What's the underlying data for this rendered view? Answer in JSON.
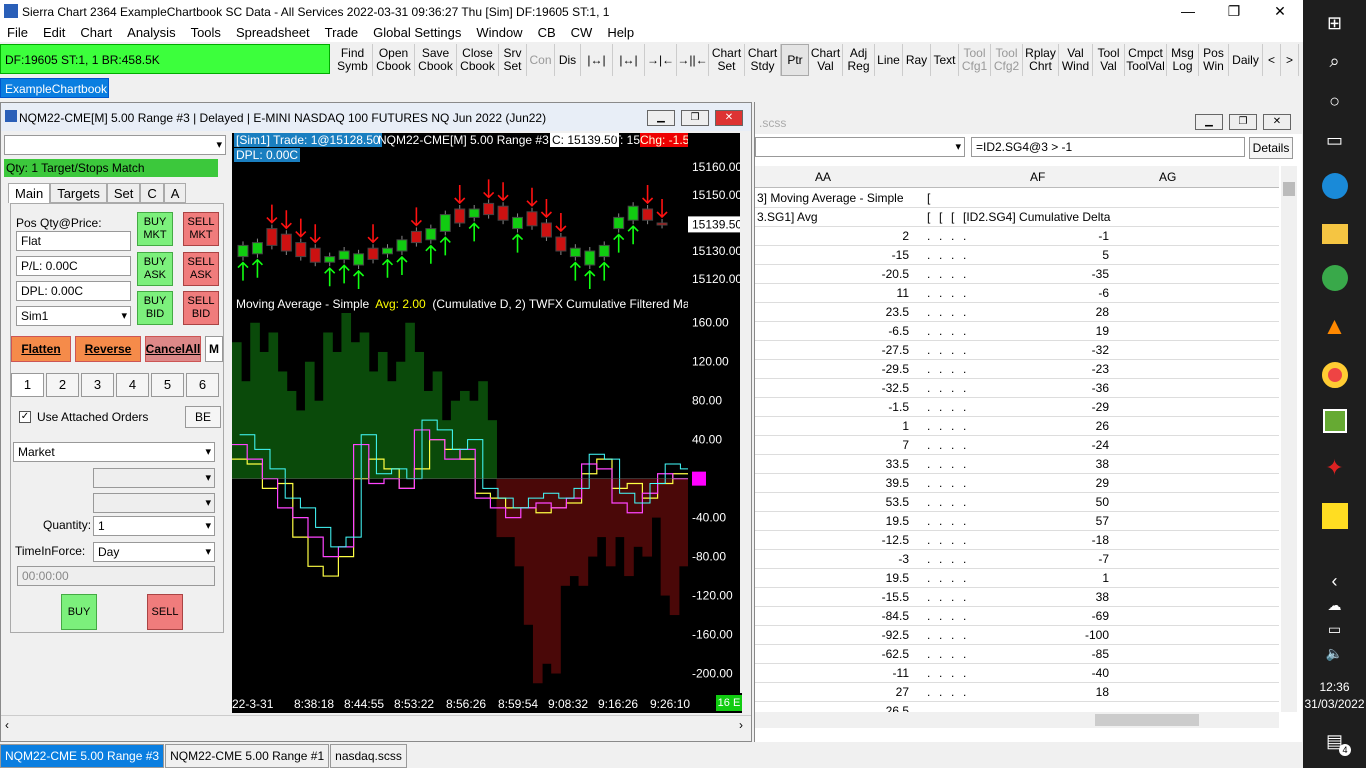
{
  "app": {
    "title": "Sierra Chart 2364 ExampleChartbook  SC Data - All Services 2022-03-31  09:36:27 Thu [Sim]  DF:19605  ST:1, 1"
  },
  "menu": [
    "File",
    "Edit",
    "Chart",
    "Analysis",
    "Tools",
    "Spreadsheet",
    "Trade",
    "Global Settings",
    "Window",
    "CB",
    "CW",
    "Help"
  ],
  "status_bar": "DF:19605  ST:1, 1   BR:458.5K",
  "toolbar": [
    {
      "label": "Find Symb",
      "dis": false
    },
    {
      "label": "Open Cbook",
      "dis": false
    },
    {
      "label": "Save Cbook",
      "dis": false
    },
    {
      "label": "Close Cbook",
      "dis": false
    },
    {
      "label": "Srv Set",
      "dis": false
    },
    {
      "label": "Con",
      "dis": true
    },
    {
      "label": "Dis",
      "dis": false
    },
    {
      "label": "|↔|",
      "dis": false
    },
    {
      "label": "|↔|",
      "dis": false
    },
    {
      "label": "→|←",
      "dis": false
    },
    {
      "label": "→||←",
      "dis": false
    },
    {
      "label": "Chart Set",
      "dis": false
    },
    {
      "label": "Chart Stdy",
      "dis": false
    },
    {
      "label": "Ptr",
      "dis": false
    },
    {
      "label": "Chart Val",
      "dis": false
    },
    {
      "label": "Adj Reg",
      "dis": false
    },
    {
      "label": "Line",
      "dis": false
    },
    {
      "label": "Ray",
      "dis": false
    },
    {
      "label": "Text",
      "dis": false
    },
    {
      "label": "Tool Cfg1",
      "dis": true
    },
    {
      "label": "Tool Cfg2",
      "dis": true
    },
    {
      "label": "Rplay Chrt",
      "dis": false
    },
    {
      "label": "Val Wind",
      "dis": false
    },
    {
      "label": "Tool Val",
      "dis": false
    },
    {
      "label": "Cmpct ToolVal",
      "dis": false
    },
    {
      "label": "Msg Log",
      "dis": false
    },
    {
      "label": "Pos Win",
      "dis": false
    },
    {
      "label": "Daily",
      "dis": false
    },
    {
      "label": "<",
      "dis": false
    },
    {
      "label": ">",
      "dis": false
    }
  ],
  "chartbook_tab": "ExampleChartbook",
  "chart_window": {
    "title": "NQM22-CME[M]  5.00 Range  #3 | Delayed | E-MINI NASDAQ 100 FUTURES NQ Jun 2022 (Jun22)"
  },
  "trade": {
    "target_match": "Qty: 1 Target/Stops Match",
    "tabs": [
      "Main",
      "Targets",
      "Set",
      "C",
      "A"
    ],
    "pos_label": "Pos Qty@Price:",
    "pos_value": "Flat",
    "pl_value": "P/L: 0.00C",
    "dpl_value": "DPL: 0.00C",
    "account": "Sim1",
    "buy_mkt": "BUY MKT",
    "sell_mkt": "SELL MKT",
    "buy_ask": "BUY ASK",
    "sell_ask": "SELL ASK",
    "buy_bid": "BUY BID",
    "sell_bid": "SELL BID",
    "flatten": "Flatten",
    "reverse": "Reverse",
    "cancel_all": "CancelAll",
    "m": "M",
    "nums": [
      "1",
      "2",
      "3",
      "4",
      "5",
      "6"
    ],
    "use_attached": "Use Attached Orders",
    "be": "BE",
    "order_type": "Market",
    "quantity_label": "Quantity:",
    "quantity": "1",
    "tif_label": "TimeInForce:",
    "tif": "Day",
    "time": "00:00:00",
    "buy": "BUY",
    "sell": "SELL"
  },
  "chart": {
    "header_left": "[Sim1]  Trade: 1@15128.50",
    "header_symbol": "NQM22-CME[M]  5.00 Range  #3",
    "header_c": "C: 15139.50",
    "header_t": "T: 15",
    "header_chg": "Chg: -1.5",
    "dpl": "DPL: 0.00C",
    "study_label": "Moving Average - Simple",
    "study_avg": "Avg: 2.00",
    "study_rest": "(Cumulative D, 2)  TWFX Cumulative Filtered Ma",
    "price_ticks": [
      "15160.00",
      "15150.00",
      "15140.00",
      "15130.00",
      "15120.00"
    ],
    "price_last": "15139.50",
    "study_ticks": [
      "160.00",
      "120.00",
      "80.00",
      "40.00",
      "0",
      "-40.00",
      "-80.00",
      "-120.00",
      "-160.00",
      "-200.00"
    ],
    "x_ticks": [
      "22-3-31",
      "8:38:18",
      "8:44:55",
      "8:53:22",
      "8:56:26",
      "8:59:54",
      "9:08:32",
      "9:16:26",
      "9:26:10"
    ],
    "x_badge": "16 E"
  },
  "chart_data": {
    "type": "bar",
    "title": "NQM22-CME[M]  5.00 Range  #3",
    "price_ylim": [
      15115,
      15165
    ],
    "study_ylim": [
      -220,
      170
    ],
    "candles": [
      {
        "o": 15128,
        "c": 15132,
        "up": true
      },
      {
        "o": 15129,
        "c": 15133,
        "up": true
      },
      {
        "o": 15138,
        "c": 15132,
        "up": false
      },
      {
        "o": 15136,
        "c": 15130,
        "up": false
      },
      {
        "o": 15133,
        "c": 15128,
        "up": false
      },
      {
        "o": 15131,
        "c": 15126,
        "up": false
      },
      {
        "o": 15126,
        "c": 15128,
        "up": true
      },
      {
        "o": 15127,
        "c": 15130,
        "up": true
      },
      {
        "o": 15125,
        "c": 15129,
        "up": true
      },
      {
        "o": 15131,
        "c": 15127,
        "up": false
      },
      {
        "o": 15129,
        "c": 15131,
        "up": true
      },
      {
        "o": 15130,
        "c": 15134,
        "up": true
      },
      {
        "o": 15137,
        "c": 15133,
        "up": false
      },
      {
        "o": 15134,
        "c": 15138,
        "up": true
      },
      {
        "o": 15137,
        "c": 15143,
        "up": true
      },
      {
        "o": 15145,
        "c": 15140,
        "up": false
      },
      {
        "o": 15142,
        "c": 15145,
        "up": true
      },
      {
        "o": 15147,
        "c": 15143,
        "up": false
      },
      {
        "o": 15146,
        "c": 15141,
        "up": false
      },
      {
        "o": 15138,
        "c": 15142,
        "up": true
      },
      {
        "o": 15144,
        "c": 15139,
        "up": false
      },
      {
        "o": 15140,
        "c": 15135,
        "up": false
      },
      {
        "o": 15135,
        "c": 15130,
        "up": false
      },
      {
        "o": 15128,
        "c": 15131,
        "up": true
      },
      {
        "o": 15125,
        "c": 15130,
        "up": true
      },
      {
        "o": 15128,
        "c": 15132,
        "up": true
      },
      {
        "o": 15138,
        "c": 15142,
        "up": true
      },
      {
        "o": 15141,
        "c": 15146,
        "up": true
      },
      {
        "o": 15145,
        "c": 15141,
        "up": false
      },
      {
        "o": 15140,
        "c": 15139.5,
        "up": false
      }
    ],
    "histogram": [
      140,
      100,
      160,
      130,
      150,
      110,
      90,
      70,
      120,
      80,
      150,
      130,
      170,
      140,
      150,
      110,
      130,
      100,
      120,
      160,
      130,
      90,
      110,
      60,
      80,
      90,
      80,
      100,
      60,
      -60,
      -60,
      -90,
      -150,
      -210,
      -190,
      -200,
      -110,
      -100,
      -110,
      -80,
      -60,
      -90,
      -60,
      -100,
      -70,
      -80,
      -40,
      -120,
      -140,
      -90
    ],
    "series": [
      {
        "name": "Moving Average - Simple",
        "values": [
          20,
          15,
          -10,
          -5,
          -60,
          -90,
          -100,
          -80,
          0,
          20,
          10,
          -10,
          10,
          40,
          30,
          20,
          -15,
          -20,
          -30,
          -30,
          -35,
          -30,
          -25,
          5,
          20,
          -10,
          -5,
          -20,
          -5,
          5
        ]
      },
      {
        "name": "TWFX Cumulative Filtered Ma",
        "values": [
          35,
          20,
          0,
          -30,
          -40,
          -60,
          -80,
          -70,
          35,
          -5,
          0,
          -10,
          50,
          40,
          20,
          30,
          -20,
          -30,
          -40,
          -30,
          -25,
          -30,
          -20,
          15,
          10,
          -25,
          -35,
          -15,
          5,
          0
        ]
      }
    ]
  },
  "ss": {
    "title": ".scss",
    "formula": "=ID2.SG4@3 > -1",
    "details": "Details",
    "col_aa": "AA",
    "col_af": "AF",
    "col_ag": "AG",
    "hdr_aa_1": "3] Moving Average - Simple",
    "hdr_aa_2": "3.SG1] Avg",
    "hdr_af_2": "[ID2.SG4] Cumulative Delta",
    "rows": [
      {
        "aa": "2",
        "af": "-1"
      },
      {
        "aa": "-15",
        "af": "5"
      },
      {
        "aa": "-20.5",
        "af": "-35"
      },
      {
        "aa": "11",
        "af": "-6"
      },
      {
        "aa": "23.5",
        "af": "28"
      },
      {
        "aa": "-6.5",
        "af": "19"
      },
      {
        "aa": "-27.5",
        "af": "-32"
      },
      {
        "aa": "-29.5",
        "af": "-23"
      },
      {
        "aa": "-32.5",
        "af": "-36"
      },
      {
        "aa": "-1.5",
        "af": "-29"
      },
      {
        "aa": "1",
        "af": "26"
      },
      {
        "aa": "7",
        "af": "-24"
      },
      {
        "aa": "33.5",
        "af": "38"
      },
      {
        "aa": "39.5",
        "af": "29"
      },
      {
        "aa": "53.5",
        "af": "50"
      },
      {
        "aa": "19.5",
        "af": "57"
      },
      {
        "aa": "-12.5",
        "af": "-18"
      },
      {
        "aa": "-3",
        "af": "-7"
      },
      {
        "aa": "19.5",
        "af": "1"
      },
      {
        "aa": "-15.5",
        "af": "38"
      },
      {
        "aa": "-84.5",
        "af": "-69"
      },
      {
        "aa": "-92.5",
        "af": "-100"
      },
      {
        "aa": "-62.5",
        "af": "-85"
      },
      {
        "aa": "-11",
        "af": "-40"
      },
      {
        "aa": "27",
        "af": "18"
      },
      {
        "aa": "26.5",
        "af": ""
      }
    ]
  },
  "tabs": [
    "NQM22-CME  5.00 Range  #3",
    "NQM22-CME  5.00 Range  #1",
    "nasdaq.scss"
  ],
  "clock": {
    "time": "12:36",
    "date": "31/03/2022"
  },
  "notif_count": "4"
}
